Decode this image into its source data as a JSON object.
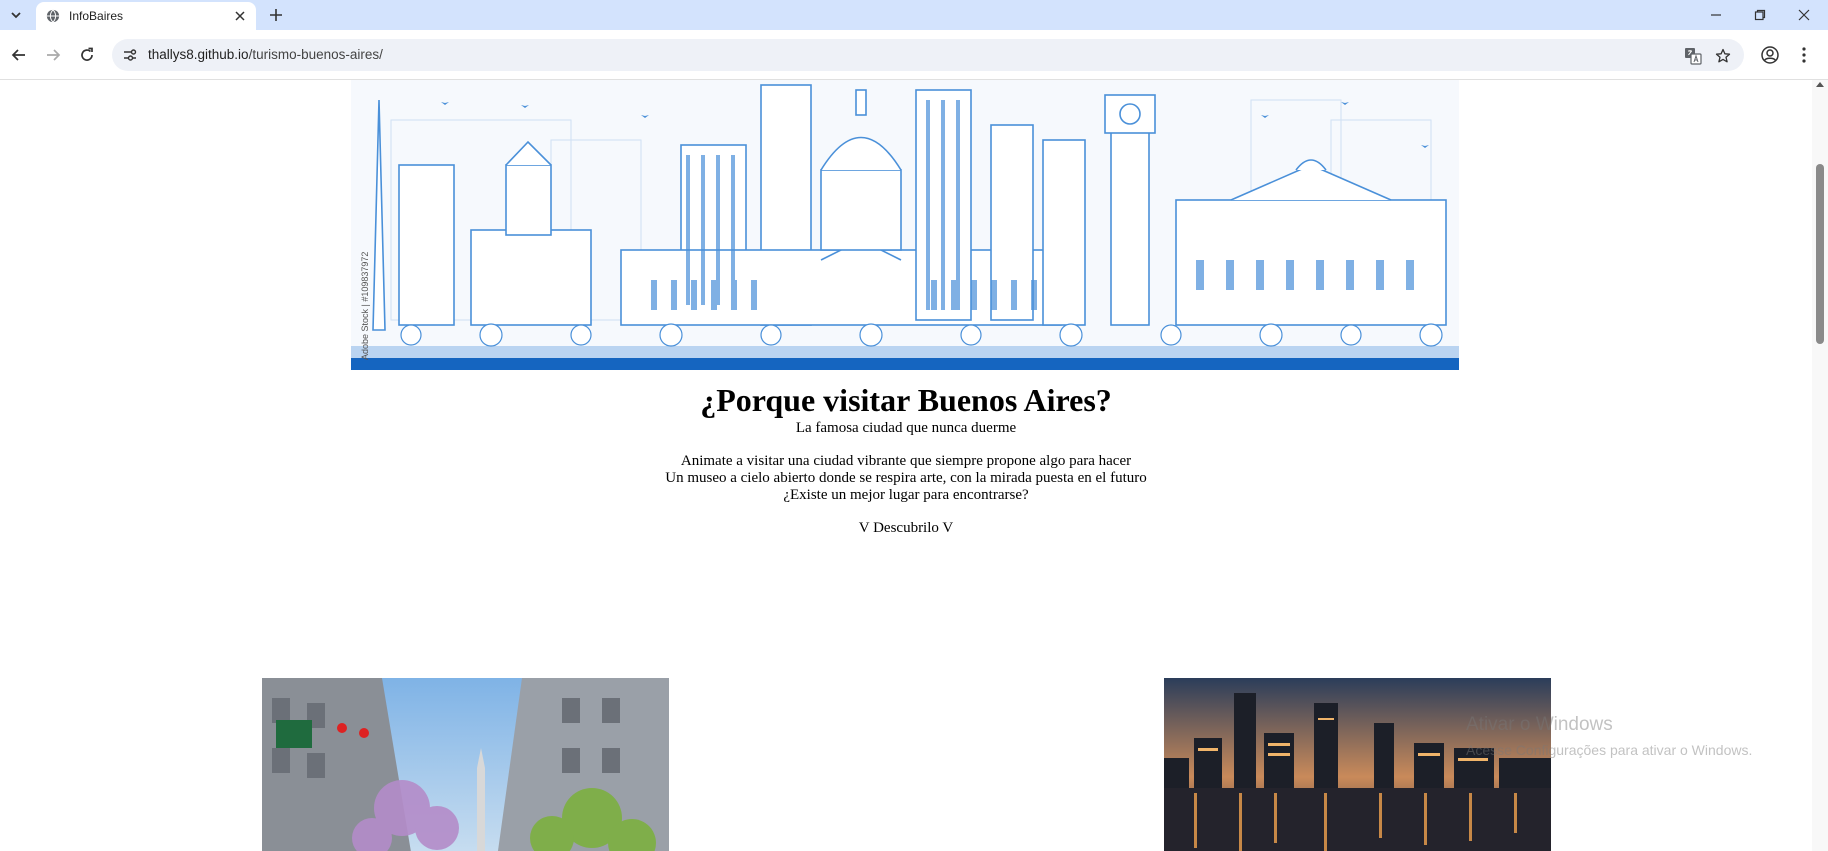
{
  "browser": {
    "tab_title": "InfoBaires",
    "url_host": "thallys8.github.io",
    "url_path": "/turismo-buenos-aires/"
  },
  "page": {
    "hero_credit": "Adobe Stock | #109837972",
    "heading": "¿Porque visitar Buenos Aires?",
    "subtitle": "La famosa ciudad que nunca duerme",
    "lines": [
      "Animate a visitar una ciudad vibrante que siempre propone algo para hacer",
      "Un museo a cielo abierto donde se respira arte, con la mirada puesta en el futuro",
      "¿Existe un mejor lugar para encontrarse?"
    ],
    "cta": "V Descubrilo V"
  },
  "os": {
    "watermark_title": "Ativar o Windows",
    "watermark_sub": "Acesse Configurações para ativar o Windows."
  },
  "colors": {
    "tabstrip": "#d3e3fd",
    "skyline": "#4a90d9",
    "skyline_dark": "#1565c0"
  }
}
